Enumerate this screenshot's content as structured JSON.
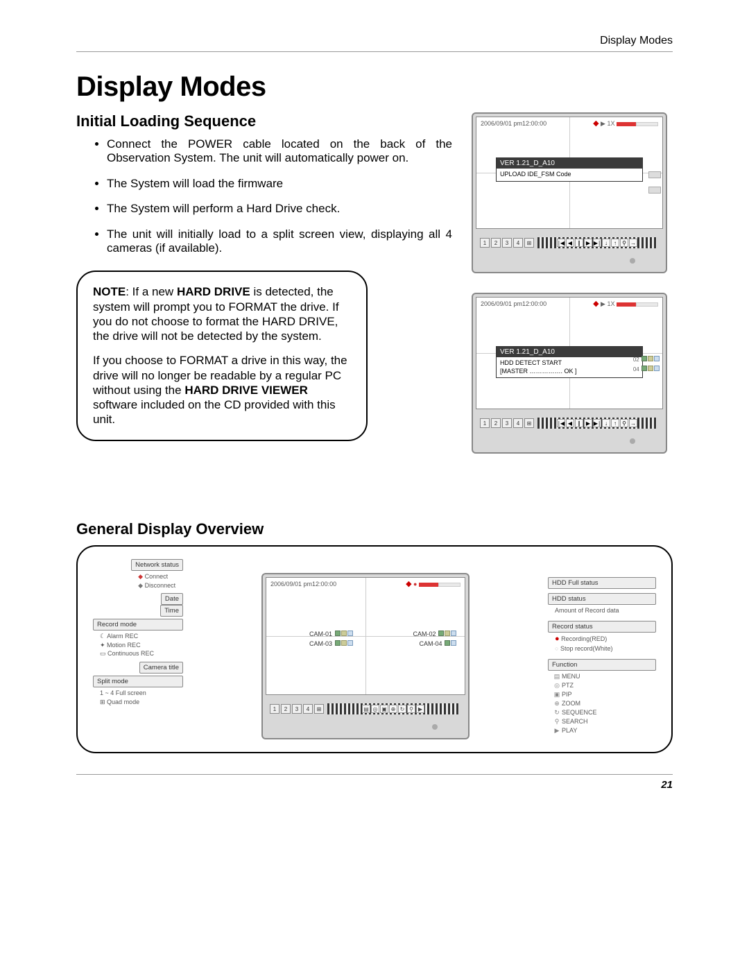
{
  "breadcrumb": "Display Modes",
  "title": "Display Modes",
  "section1": {
    "heading": "Initial Loading Sequence",
    "bullets": [
      "Connect the POWER cable located on the back of the Observation System. The unit will automatically power on.",
      "The System will load the firmware",
      "The System will perform a Hard Drive check.",
      "The unit will initially load to a split screen view, displaying all 4 cameras (if available)."
    ],
    "note_label": "NOTE",
    "note_p1a": ": If a new ",
    "note_strong1": "HARD DRIVE",
    "note_p1b": " is detected, the system will prompt you to FORMAT the drive. If you do not choose to format the HARD DRIVE, the drive will not be detected by the system.",
    "note_p2a": "If you choose to FORMAT a drive in this way, the drive will no longer be readable by a regular PC without using the ",
    "note_strong2": "HARD DRIVE VIEWER",
    "note_p2b": " software included on the CD provided with this unit."
  },
  "monitor1": {
    "timestamp": "2006/09/01 pm12:00:00",
    "top_right": "1X",
    "version": "VER 1.21_D_A10",
    "body": "UPLOAD  IDE_FSM Code",
    "buttons": [
      "1",
      "2",
      "3",
      "4"
    ],
    "quad": "⊞",
    "film_icons": [
      "∣◀",
      "◀",
      "∥",
      "▶",
      "▶∣",
      "↓",
      "↑",
      "⚲",
      "→"
    ]
  },
  "monitor2": {
    "timestamp": "2006/09/01 pm12:00:00",
    "top_right": "1X",
    "version": "VER 1.21_D_A10",
    "body1": "HDD DETECT START",
    "body2": "[MASTER ……………. OK ]",
    "right_tags": [
      "02",
      "04"
    ],
    "buttons": [
      "1",
      "2",
      "3",
      "4"
    ],
    "quad": "⊞",
    "film_icons": [
      "∣◀",
      "◀",
      "∥",
      "▶",
      "▶∣",
      "↓",
      "↑",
      "⚲",
      "→"
    ]
  },
  "section2": {
    "heading": "General Display Overview"
  },
  "overview": {
    "left": {
      "network_status": "Network status",
      "net_connect": "Connect",
      "net_disconnect": "Disconnect",
      "date": "Date",
      "time": "Time",
      "record_mode": "Record mode",
      "alarm_rec": "Alarm REC",
      "motion_rec": "Motion REC",
      "continuous_rec": "Continuous REC",
      "camera_title": "Camera title",
      "split_mode": "Split mode",
      "full_screen": "1 ~ 4  Full screen",
      "quad_mode": "Quad mode"
    },
    "center": {
      "timestamp": "2006/09/01 pm12:00:00",
      "cam1": "CAM-01",
      "cam2": "CAM-02",
      "cam3": "CAM-03",
      "cam4": "CAM-04",
      "buttons": [
        "1",
        "2",
        "3",
        "4"
      ],
      "quad": "⊞"
    },
    "right": {
      "hdd_full": "HDD Full status",
      "hdd_status": "HDD status",
      "hdd_sub": "Amount of Record data",
      "record_status": "Record status",
      "recording_red": "Recording(RED)",
      "stop_white": "Stop record(White)",
      "function": "Function",
      "menu": "MENU",
      "ptz": "PTZ",
      "pip": "PIP",
      "zoom": "ZOOM",
      "sequence": "SEQUENCE",
      "search": "SEARCH",
      "play": "PLAY"
    }
  },
  "page_number": "21"
}
